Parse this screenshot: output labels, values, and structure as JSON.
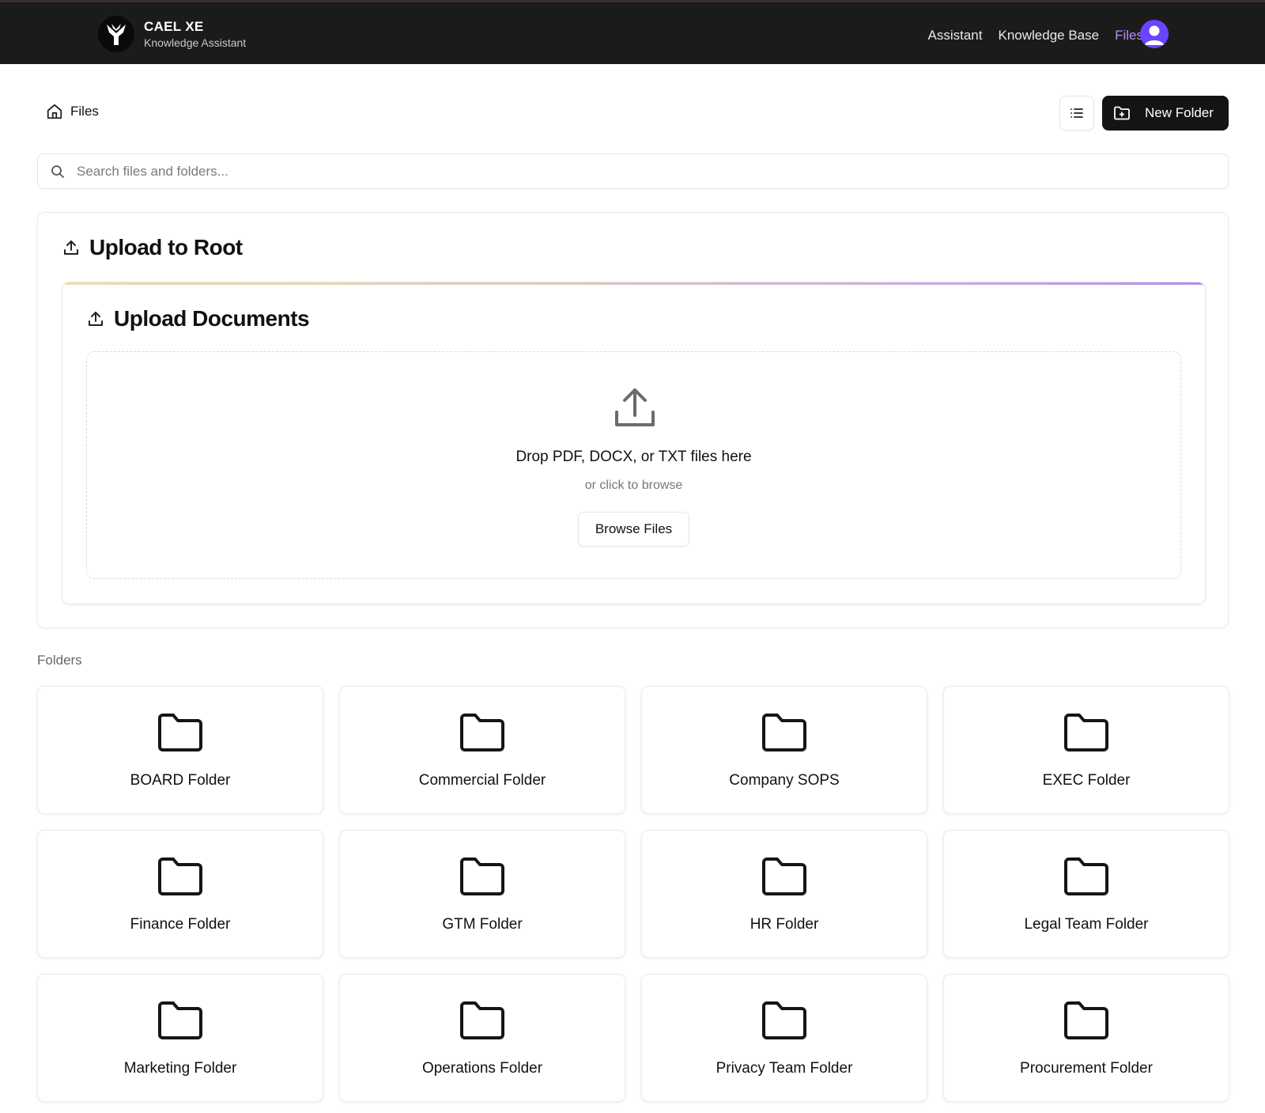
{
  "header": {
    "brand_name": "CAEL XE",
    "brand_subtitle": "Knowledge Assistant",
    "nav": [
      {
        "label": "Assistant",
        "active": false
      },
      {
        "label": "Knowledge Base",
        "active": false
      },
      {
        "label": "Files",
        "active": true
      }
    ],
    "accent_color": "#b58cff",
    "avatar_color": "#6a44ff"
  },
  "breadcrumb": {
    "label": "Files",
    "icon": "home-icon"
  },
  "toolbar": {
    "list_view_icon": "list-icon",
    "new_folder_label": "New Folder",
    "new_folder_icon": "folder-plus-icon"
  },
  "search": {
    "placeholder": "Search files and folders...",
    "value": ""
  },
  "upload": {
    "card_title": "Upload to Root",
    "inner_title": "Upload Documents",
    "drop_text": "Drop PDF, DOCX, or TXT files here",
    "drop_subtext": "or click to browse",
    "browse_label": "Browse Files"
  },
  "folders": {
    "section_label": "Folders",
    "items": [
      "BOARD Folder",
      "Commercial Folder",
      "Company SOPS",
      "EXEC Folder",
      "Finance Folder",
      "GTM Folder",
      "HR Folder",
      "Legal Team Folder",
      "Marketing Folder",
      "Operations Folder",
      "Privacy Team Folder",
      "Procurement Folder"
    ]
  }
}
